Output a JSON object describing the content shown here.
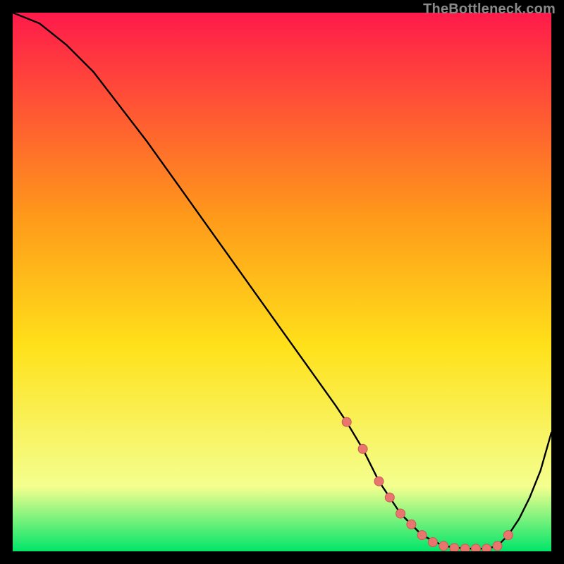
{
  "attribution": "TheBottleneck.com",
  "colors": {
    "top": "#ff1a4b",
    "mid1": "#ff9a1a",
    "mid2": "#ffe11a",
    "low": "#f4ff8f",
    "bottom": "#00e56a",
    "curve": "#000000",
    "marker_fill": "#e8766f",
    "marker_stroke": "#c95a54"
  },
  "chart_data": {
    "type": "line",
    "title": "",
    "xlabel": "",
    "ylabel": "",
    "xlim": [
      0,
      100
    ],
    "ylim": [
      0,
      100
    ],
    "grid": false,
    "legend": false,
    "series": [
      {
        "name": "bottleneck-curve",
        "x": [
          0,
          5,
          10,
          15,
          20,
          25,
          30,
          35,
          40,
          45,
          50,
          55,
          60,
          62,
          65,
          68,
          72,
          76,
          80,
          84,
          88,
          90,
          92,
          94,
          96,
          98,
          100
        ],
        "y": [
          100,
          98,
          94,
          89,
          82.5,
          76,
          69,
          62,
          55,
          48,
          41,
          34,
          27,
          24,
          19,
          13,
          7,
          3,
          1,
          0.5,
          0.5,
          1,
          3,
          6,
          10,
          15,
          22
        ]
      }
    ],
    "markers": {
      "name": "highlight-dots",
      "x": [
        62,
        65,
        68,
        70,
        72,
        74,
        76,
        78,
        80,
        82,
        84,
        86,
        88,
        90,
        92
      ],
      "y": [
        24,
        19,
        13,
        10,
        7,
        5,
        3,
        1.7,
        1,
        0.6,
        0.5,
        0.5,
        0.5,
        1,
        3
      ]
    }
  }
}
